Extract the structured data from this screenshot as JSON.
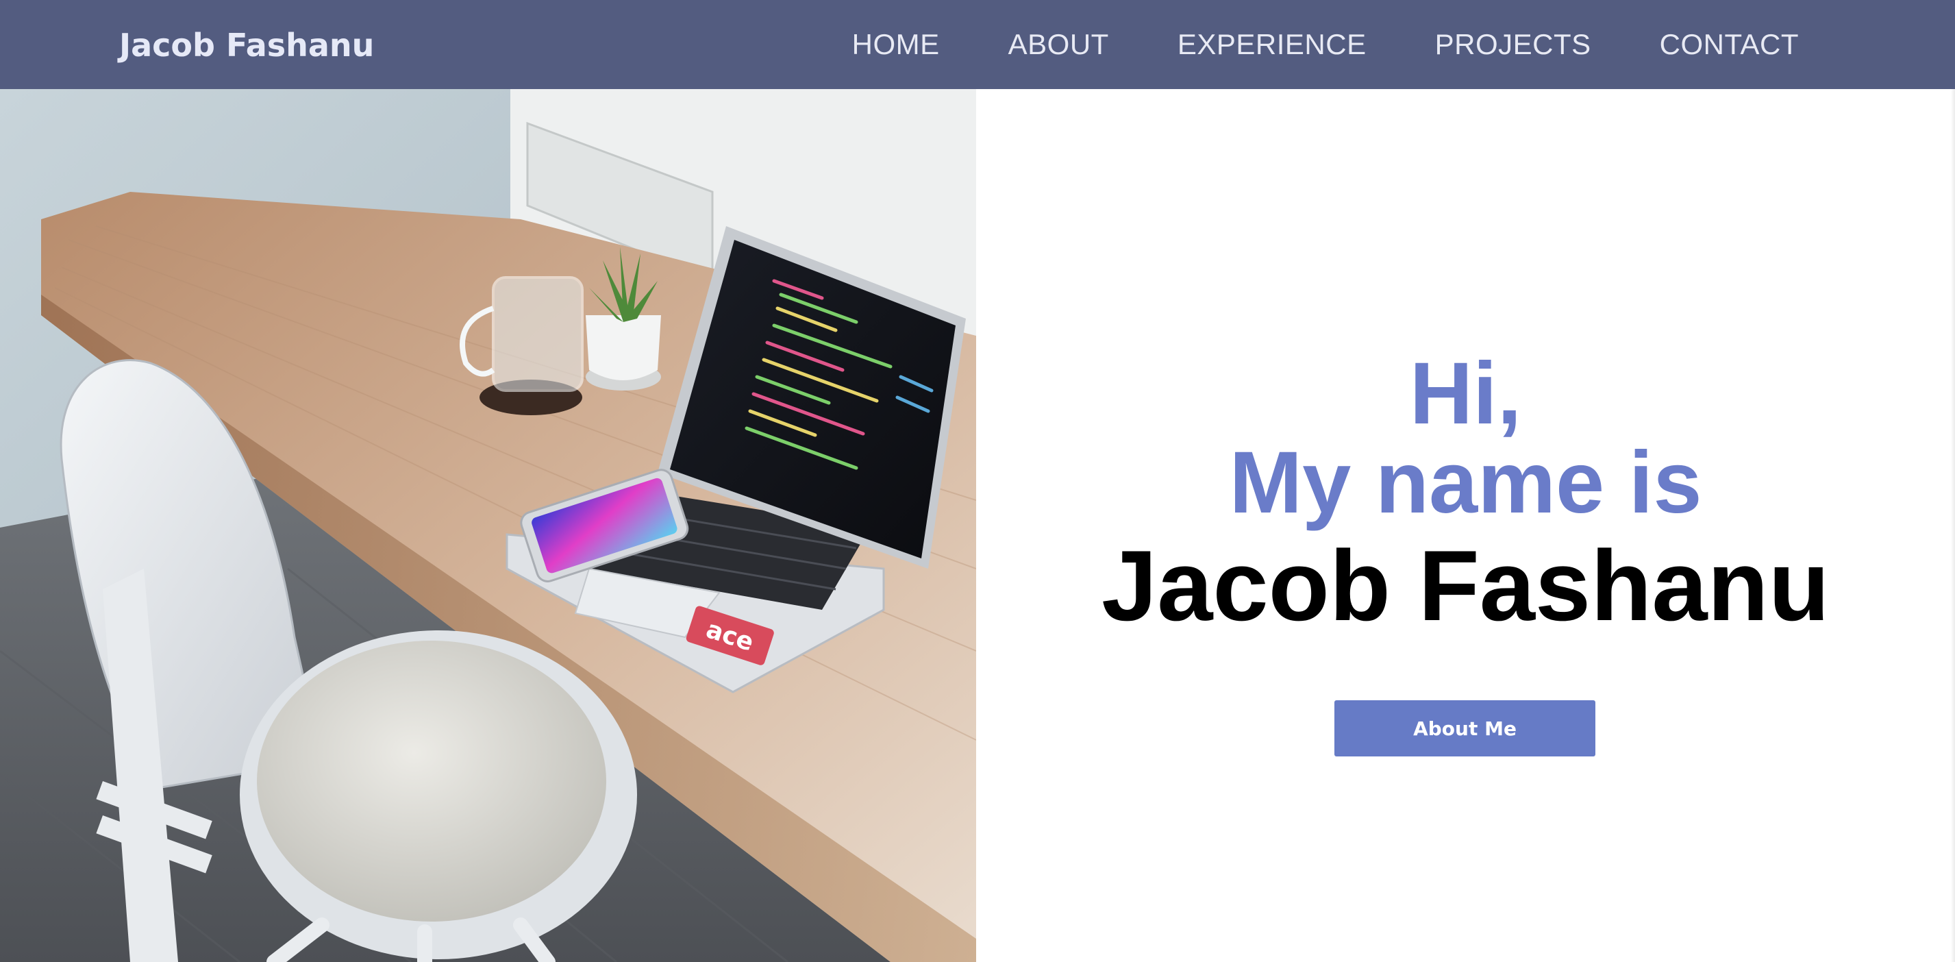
{
  "header": {
    "brand": "Jacob Fashanu",
    "nav": [
      "HOME",
      "ABOUT",
      "EXPERIENCE",
      "PROJECTS",
      "CONTACT"
    ]
  },
  "hero": {
    "greeting_line1": "Hi,",
    "greeting_line2": "My name is",
    "name": "Jacob Fashanu",
    "button_label": "About Me",
    "sticker_text": "ace"
  },
  "colors": {
    "navbar_bg": "#535c80",
    "accent": "#667bc6",
    "greeting_text": "#6a7cc9",
    "name_text": "#000000"
  }
}
